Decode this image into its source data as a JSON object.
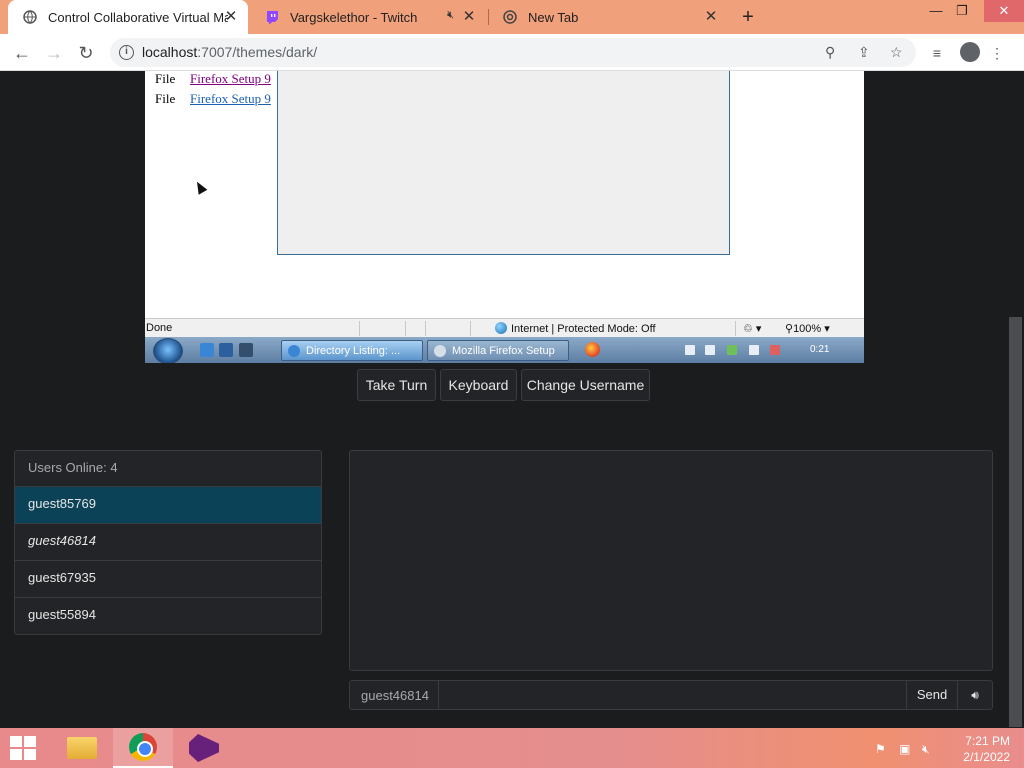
{
  "browser": {
    "tabs": [
      {
        "title": "Control Collaborative Virtual Ma",
        "active": true,
        "favicon": "globe-icon"
      },
      {
        "title": "Vargskelethor - Twitch",
        "active": false,
        "favicon": "twitch-icon",
        "muted": true
      },
      {
        "title": "New Tab",
        "active": false,
        "favicon": "chrome-icon"
      }
    ],
    "url_host": "localhost",
    "url_port": ":7007",
    "url_path": "/themes/dark/"
  },
  "vm": {
    "rows": [
      {
        "label": "File",
        "link": "Firefox Setup 9"
      },
      {
        "label": "File",
        "link": "Firefox Setup 9"
      }
    ],
    "status": "Done",
    "zone": "Internet | Protected Mode: Off",
    "zoom": "100%",
    "tasks": [
      "Directory Listing: ...",
      "Mozilla Firefox Setup"
    ],
    "clock": "0:21"
  },
  "controls": {
    "take_turn": "Take Turn",
    "keyboard": "Keyboard",
    "change_username": "Change Username"
  },
  "users": {
    "header": "Users Online: 4",
    "list": [
      "guest85769",
      "guest46814",
      "guest67935",
      "guest55894"
    ]
  },
  "chat": {
    "username": "guest46814",
    "input_value": "",
    "send": "Send"
  },
  "taskbar": {
    "time": "7:21 PM",
    "date": "2/1/2022"
  }
}
